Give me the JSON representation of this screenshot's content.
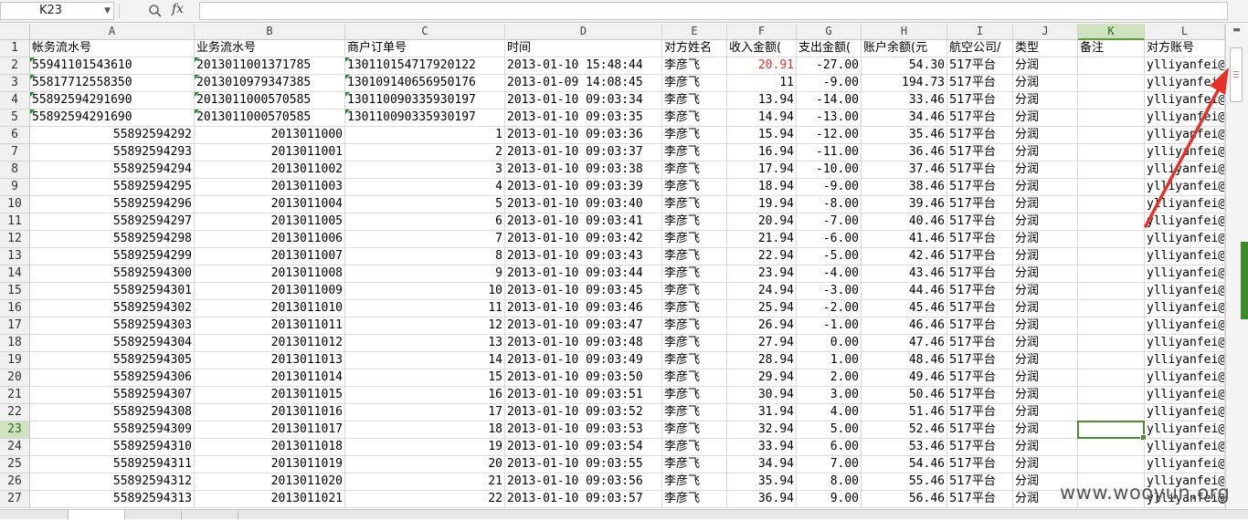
{
  "formula_bar": {
    "cell_ref": "K23",
    "fx_label": "fx",
    "formula": ""
  },
  "columns": [
    {
      "letter": "A"
    },
    {
      "letter": "B"
    },
    {
      "letter": "C"
    },
    {
      "letter": "D"
    },
    {
      "letter": "E"
    },
    {
      "letter": "F"
    },
    {
      "letter": "G"
    },
    {
      "letter": "H"
    },
    {
      "letter": "I"
    },
    {
      "letter": "J"
    },
    {
      "letter": "K",
      "selected": true
    },
    {
      "letter": "L"
    }
  ],
  "header_row": [
    "帐务流水号",
    "业务流水号",
    "商户订单号",
    "时间",
    "对方姓名",
    "收入金额(",
    "支出金额(",
    "账户余额(元",
    "航空公司/",
    "类型",
    "备注",
    "对方账号"
  ],
  "rows": [
    {
      "num": "2",
      "a": "55941101543610",
      "b": "2013011001371785",
      "c": "130110154717920122",
      "d": "2013-01-10 15:48:44",
      "e": "李彦飞",
      "f": "20.91",
      "g": "-27.00",
      "h": "54.30",
      "i": "517平台",
      "j": "分润",
      "k": "",
      "l": "ylliyanfei@"
    },
    {
      "num": "3",
      "a": "55817712558350",
      "b": "2013010979347385",
      "c": "130109140656950176",
      "d": "2013-01-09 14:08:45",
      "e": "李彦飞",
      "f": "11",
      "g": "-9.00",
      "h": "194.73",
      "i": "517平台",
      "j": "分润",
      "k": "",
      "l": "ylliyanfei@"
    },
    {
      "num": "4",
      "a": "55892594291690",
      "b": "2013011000570585",
      "c": "130110090335930197",
      "d": "2013-01-10 09:03:34",
      "e": "李彦飞",
      "f": "13.94",
      "g": "-14.00",
      "h": "33.46",
      "i": "517平台",
      "j": "分润",
      "k": "",
      "l": "ylliyanfei@"
    },
    {
      "num": "5",
      "a": "55892594291690",
      "b": "2013011000570585",
      "c": "130110090335930197",
      "d": "2013-01-10 09:03:35",
      "e": "李彦飞",
      "f": "14.94",
      "g": "-13.00",
      "h": "34.46",
      "i": "517平台",
      "j": "分润",
      "k": "",
      "l": "ylliyanfei@"
    },
    {
      "num": "6",
      "a": "55892594292",
      "b": "2013011000",
      "c": "1",
      "d": "2013-01-10 09:03:36",
      "e": "李彦飞",
      "f": "15.94",
      "g": "-12.00",
      "h": "35.46",
      "i": "517平台",
      "j": "分润",
      "k": "",
      "l": "ylliyanfei@"
    },
    {
      "num": "7",
      "a": "55892594293",
      "b": "2013011001",
      "c": "2",
      "d": "2013-01-10 09:03:37",
      "e": "李彦飞",
      "f": "16.94",
      "g": "-11.00",
      "h": "36.46",
      "i": "517平台",
      "j": "分润",
      "k": "",
      "l": "ylliyanfei@"
    },
    {
      "num": "8",
      "a": "55892594294",
      "b": "2013011002",
      "c": "3",
      "d": "2013-01-10 09:03:38",
      "e": "李彦飞",
      "f": "17.94",
      "g": "-10.00",
      "h": "37.46",
      "i": "517平台",
      "j": "分润",
      "k": "",
      "l": "ylliyanfei@"
    },
    {
      "num": "9",
      "a": "55892594295",
      "b": "2013011003",
      "c": "4",
      "d": "2013-01-10 09:03:39",
      "e": "李彦飞",
      "f": "18.94",
      "g": "-9.00",
      "h": "38.46",
      "i": "517平台",
      "j": "分润",
      "k": "",
      "l": "ylliyanfei@"
    },
    {
      "num": "10",
      "a": "55892594296",
      "b": "2013011004",
      "c": "5",
      "d": "2013-01-10 09:03:40",
      "e": "李彦飞",
      "f": "19.94",
      "g": "-8.00",
      "h": "39.46",
      "i": "517平台",
      "j": "分润",
      "k": "",
      "l": "ylliyanfei@"
    },
    {
      "num": "11",
      "a": "55892594297",
      "b": "2013011005",
      "c": "6",
      "d": "2013-01-10 09:03:41",
      "e": "李彦飞",
      "f": "20.94",
      "g": "-7.00",
      "h": "40.46",
      "i": "517平台",
      "j": "分润",
      "k": "",
      "l": "ylliyanfei@"
    },
    {
      "num": "12",
      "a": "55892594298",
      "b": "2013011006",
      "c": "7",
      "d": "2013-01-10 09:03:42",
      "e": "李彦飞",
      "f": "21.94",
      "g": "-6.00",
      "h": "41.46",
      "i": "517平台",
      "j": "分润",
      "k": "",
      "l": "ylliyanfei@"
    },
    {
      "num": "13",
      "a": "55892594299",
      "b": "2013011007",
      "c": "8",
      "d": "2013-01-10 09:03:43",
      "e": "李彦飞",
      "f": "22.94",
      "g": "-5.00",
      "h": "42.46",
      "i": "517平台",
      "j": "分润",
      "k": "",
      "l": "ylliyanfei@"
    },
    {
      "num": "14",
      "a": "55892594300",
      "b": "2013011008",
      "c": "9",
      "d": "2013-01-10 09:03:44",
      "e": "李彦飞",
      "f": "23.94",
      "g": "-4.00",
      "h": "43.46",
      "i": "517平台",
      "j": "分润",
      "k": "",
      "l": "ylliyanfei@"
    },
    {
      "num": "15",
      "a": "55892594301",
      "b": "2013011009",
      "c": "10",
      "d": "2013-01-10 09:03:45",
      "e": "李彦飞",
      "f": "24.94",
      "g": "-3.00",
      "h": "44.46",
      "i": "517平台",
      "j": "分润",
      "k": "",
      "l": "ylliyanfei@"
    },
    {
      "num": "16",
      "a": "55892594302",
      "b": "2013011010",
      "c": "11",
      "d": "2013-01-10 09:03:46",
      "e": "李彦飞",
      "f": "25.94",
      "g": "-2.00",
      "h": "45.46",
      "i": "517平台",
      "j": "分润",
      "k": "",
      "l": "ylliyanfei@"
    },
    {
      "num": "17",
      "a": "55892594303",
      "b": "2013011011",
      "c": "12",
      "d": "2013-01-10 09:03:47",
      "e": "李彦飞",
      "f": "26.94",
      "g": "-1.00",
      "h": "46.46",
      "i": "517平台",
      "j": "分润",
      "k": "",
      "l": "ylliyanfei@"
    },
    {
      "num": "18",
      "a": "55892594304",
      "b": "2013011012",
      "c": "13",
      "d": "2013-01-10 09:03:48",
      "e": "李彦飞",
      "f": "27.94",
      "g": "0.00",
      "h": "47.46",
      "i": "517平台",
      "j": "分润",
      "k": "",
      "l": "ylliyanfei@"
    },
    {
      "num": "19",
      "a": "55892594305",
      "b": "2013011013",
      "c": "14",
      "d": "2013-01-10 09:03:49",
      "e": "李彦飞",
      "f": "28.94",
      "g": "1.00",
      "h": "48.46",
      "i": "517平台",
      "j": "分润",
      "k": "",
      "l": "ylliyanfei@"
    },
    {
      "num": "20",
      "a": "55892594306",
      "b": "2013011014",
      "c": "15",
      "d": "2013-01-10 09:03:50",
      "e": "李彦飞",
      "f": "29.94",
      "g": "2.00",
      "h": "49.46",
      "i": "517平台",
      "j": "分润",
      "k": "",
      "l": "ylliyanfei@"
    },
    {
      "num": "21",
      "a": "55892594307",
      "b": "2013011015",
      "c": "16",
      "d": "2013-01-10 09:03:51",
      "e": "李彦飞",
      "f": "30.94",
      "g": "3.00",
      "h": "50.46",
      "i": "517平台",
      "j": "分润",
      "k": "",
      "l": "ylliyanfei@"
    },
    {
      "num": "22",
      "a": "55892594308",
      "b": "2013011016",
      "c": "17",
      "d": "2013-01-10 09:03:52",
      "e": "李彦飞",
      "f": "31.94",
      "g": "4.00",
      "h": "51.46",
      "i": "517平台",
      "j": "分润",
      "k": "",
      "l": "ylliyanfei@"
    },
    {
      "num": "23",
      "a": "55892594309",
      "b": "2013011017",
      "c": "18",
      "d": "2013-01-10 09:03:53",
      "e": "李彦飞",
      "f": "32.94",
      "g": "5.00",
      "h": "52.46",
      "i": "517平台",
      "j": "分润",
      "k": "",
      "l": "ylliyanfei@",
      "selected": true
    },
    {
      "num": "24",
      "a": "55892594310",
      "b": "2013011018",
      "c": "19",
      "d": "2013-01-10 09:03:54",
      "e": "李彦飞",
      "f": "33.94",
      "g": "6.00",
      "h": "53.46",
      "i": "517平台",
      "j": "分润",
      "k": "",
      "l": "ylliyanfei@"
    },
    {
      "num": "25",
      "a": "55892594311",
      "b": "2013011019",
      "c": "20",
      "d": "2013-01-10 09:03:55",
      "e": "李彦飞",
      "f": "34.94",
      "g": "7.00",
      "h": "54.46",
      "i": "517平台",
      "j": "分润",
      "k": "",
      "l": "ylliyanfei@"
    },
    {
      "num": "26",
      "a": "55892594312",
      "b": "2013011020",
      "c": "21",
      "d": "2013-01-10 09:03:56",
      "e": "李彦飞",
      "f": "35.94",
      "g": "8.00",
      "h": "55.46",
      "i": "517平台",
      "j": "分润",
      "k": "",
      "l": "ylliyanfei@"
    },
    {
      "num": "27",
      "a": "55892594313",
      "b": "2013011021",
      "c": "22",
      "d": "2013-01-10 09:03:57",
      "e": "李彦飞",
      "f": "36.94",
      "g": "9.00",
      "h": "56.46",
      "i": "517平台",
      "j": "分润",
      "k": "",
      "l": "ylliyanfei@"
    }
  ],
  "highlight_color": "#e03030",
  "selection_color": "#4f8a2e",
  "watermark": "www.wooyun.org",
  "annotation": {
    "type": "red-arrow",
    "color": "#e8302a"
  }
}
